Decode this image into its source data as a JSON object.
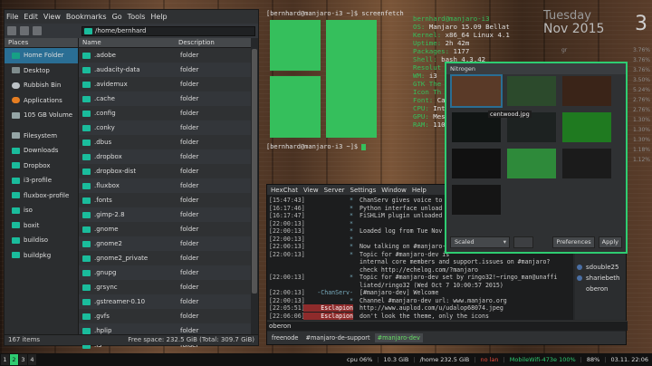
{
  "file_manager": {
    "menu": [
      "File",
      "Edit",
      "View",
      "Bookmarks",
      "Go",
      "Tools",
      "Help"
    ],
    "path": "/home/bernhard",
    "places_header": "Places",
    "places": [
      "Home Folder",
      "Desktop",
      "Rubbish Bin",
      "Applications",
      "105 GB Volume",
      "Filesystem",
      "Downloads",
      "Dropbox",
      "i3-profile",
      "fluxbox-profile",
      "iso",
      "boxit",
      "buildiso",
      "buildpkg"
    ],
    "col_name": "Name",
    "col_desc": "Description",
    "files": [
      ".adobe",
      ".audacity-data",
      ".avidemux",
      ".cache",
      ".config",
      ".conky",
      ".dbus",
      ".dropbox",
      ".dropbox-dist",
      ".fluxbox",
      ".fonts",
      ".gimp-2.8",
      ".gnome",
      ".gnome2",
      ".gnome2_private",
      ".gnupg",
      ".grsync",
      ".gstreamer-0.10",
      ".gvfs",
      ".hplip",
      ".i3"
    ],
    "file_desc": "folder",
    "status_items": "167 items",
    "status_space": "Free space: 232.5 GiB (Total: 309.7 GiB)"
  },
  "terminal": {
    "prompt1": "[bernhard@manjaro-i3 ~]$ screenfetch",
    "prompt2": "[bernhard@manjaro-i3 ~]$ ",
    "userhost": "bernhard@manjaro-i3",
    "info": [
      {
        "k": "OS:",
        "v": "Manjaro 15.09 Bellat"
      },
      {
        "k": "Kernel:",
        "v": "x86_64 Linux 4.1"
      },
      {
        "k": "Uptime:",
        "v": "2h 42m"
      },
      {
        "k": "Packages:",
        "v": "1177"
      },
      {
        "k": "Shell:",
        "v": "bash 4.3.42"
      },
      {
        "k": "Resolut",
        "v": ""
      },
      {
        "k": "WM:",
        "v": "i3"
      },
      {
        "k": "GTK The",
        "v": ""
      },
      {
        "k": "Icon Th",
        "v": ""
      },
      {
        "k": "Font:",
        "v": "Ca"
      },
      {
        "k": "CPU:",
        "v": "Int"
      },
      {
        "k": "GPU:",
        "v": "Mes"
      },
      {
        "k": "RAM:",
        "v": "1109"
      }
    ]
  },
  "conky": {
    "day": "Tuesday",
    "month_year": "Nov 2015",
    "date": "3",
    "rows": [
      [
        "gr",
        "3.76%"
      ],
      [
        "",
        "3.76%"
      ],
      [
        "",
        "3.76%"
      ],
      [
        "",
        "3.50%"
      ],
      [
        "",
        "5.24%"
      ],
      [
        "",
        "2.76%"
      ],
      [
        "",
        "2.76%"
      ],
      [
        "",
        "1.30%"
      ],
      [
        "",
        "1.30%"
      ],
      [
        "",
        "1.30%"
      ],
      [
        "",
        "1.18%"
      ],
      [
        "",
        "1.12%"
      ]
    ]
  },
  "nitrogen": {
    "title": "Nitrogen",
    "selected_caption": "centwood.jpg",
    "mode": "Scaled",
    "preferences": "Preferences",
    "apply": "Apply",
    "thumb_colors": [
      "#5a3a28",
      "#2c4a2c",
      "#3a2418",
      "#111514",
      "#1d2221",
      "#1f7a20",
      "#111",
      "#2e8a3a",
      "#1b1b1b",
      "#151515"
    ]
  },
  "hexchat": {
    "title": "HexChat",
    "menu": [
      "HexChat",
      "View",
      "Server",
      "Settings",
      "Window",
      "Help"
    ],
    "log": [
      {
        "t": "[15:47:43]",
        "n": "*",
        "m": "ChanServ gives voice to"
      },
      {
        "t": "[16:17:46]",
        "n": "*",
        "m": "Python interface unload"
      },
      {
        "t": "[16:17:47]",
        "n": "*",
        "m": "FiSHLiM plugin unloaded"
      },
      {
        "t": "[22:00:13]",
        "n": "*",
        "m": ""
      },
      {
        "t": "[22:00:13]",
        "n": "*",
        "m": "Loaded log from Tue Nov"
      },
      {
        "t": "[22:00:13]",
        "n": "*",
        "m": ""
      },
      {
        "t": "[22:00:13]",
        "n": "*",
        "m": "Now talking on #manjaro-dev"
      },
      {
        "t": "[22:00:13]",
        "n": "*",
        "m": "Topic for #manjaro-dev is"
      },
      {
        "t": "",
        "n": "",
        "m": "internal core members and support.issues on #manjaro?"
      },
      {
        "t": "",
        "n": "",
        "m": "check http://echelog.com/?manjaro"
      },
      {
        "t": "[22:00:13]",
        "n": "*",
        "m": "Topic for #manjaro-dev set by ringo32!~ringo_man@unaffi"
      },
      {
        "t": "",
        "n": "",
        "m": "liated/ringo32 (Wed Oct  7 10:00:57 2015)"
      },
      {
        "t": "[22:00:13]",
        "n": "-ChanServ-",
        "m": "[#manjaro-dev] Welcome"
      },
      {
        "t": "[22:00:13]",
        "n": "*",
        "m": "Channel #manjaro-dev url: www.manjaro.org"
      },
      {
        "t": "[22:05:51]",
        "n": "Esclapion",
        "m": "http://www.auplod.com/u/udalop68074.jpeg"
      },
      {
        "t": "[22:06:06]",
        "n": "Esclapion",
        "m": "don't look the theme, only the icons"
      }
    ],
    "users": [
      "sdouble25",
      "shariebeth",
      "oberon"
    ],
    "nick": "oberon",
    "tabs": [
      "freenode",
      "#manjaro-de-support",
      "#manjaro-dev"
    ]
  },
  "bar": {
    "workspaces": [
      "1",
      "2",
      "3",
      "4"
    ],
    "active_ws": "2",
    "cpu": "cpu  06%",
    "mem": "10.3 GiB",
    "disk": "/home 232.5 GiB",
    "lan": "no lan",
    "wifi": "MobileWifi-473e 100%",
    "volume": "88%",
    "battery": "03.11.  22:06",
    "date": "03.11. 22:06"
  }
}
